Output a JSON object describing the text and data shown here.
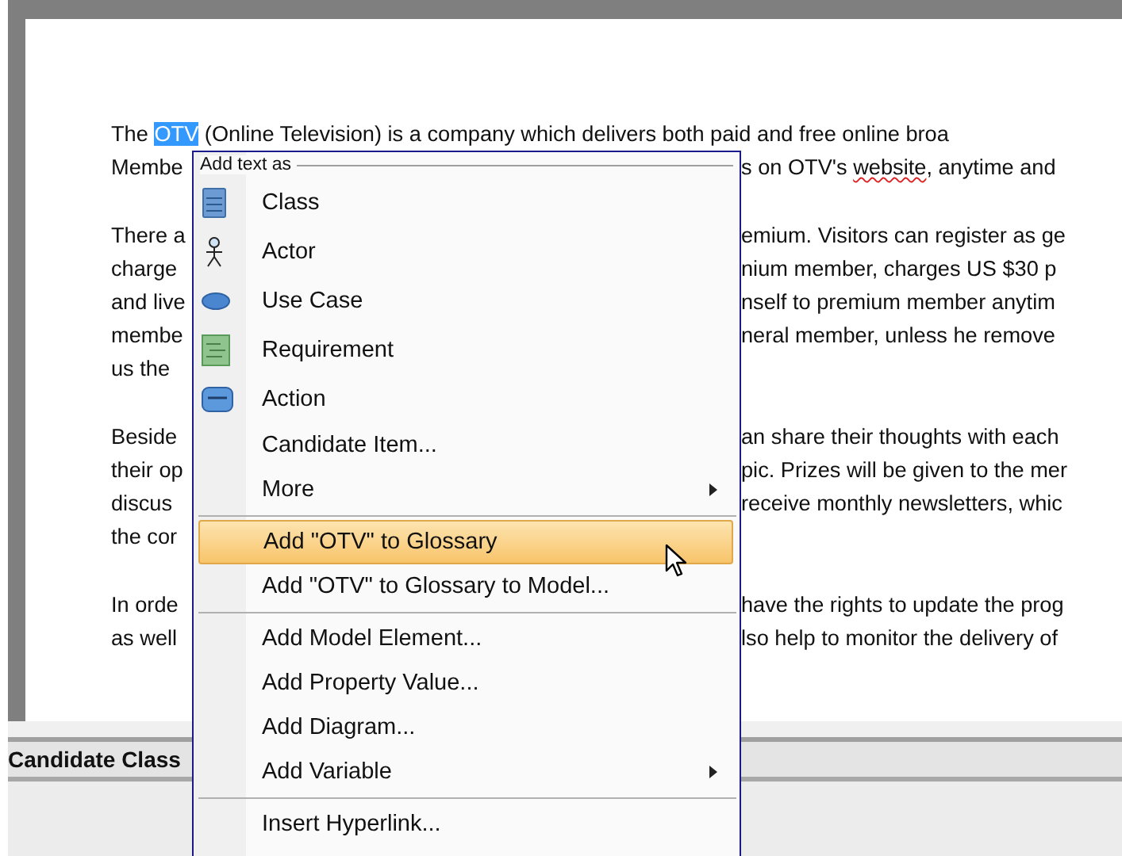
{
  "document": {
    "paragraphs": [
      {
        "lines": [
          {
            "left": [
              {
                "kind": "plain",
                "text": "The "
              },
              {
                "kind": "selected",
                "text": "OTV"
              },
              {
                "kind": "plain",
                "text": " (Online Television) is a company which delivers both paid and free online broa"
              }
            ]
          },
          {
            "left": [
              {
                "kind": "plain",
                "text": "Membe"
              }
            ],
            "right": [
              {
                "kind": "plain",
                "text": "s on OTV's "
              },
              {
                "kind": "misspelled",
                "text": "website"
              },
              {
                "kind": "plain",
                "text": ", anytime and"
              }
            ]
          }
        ]
      },
      {
        "lines": [
          {
            "left": [
              {
                "kind": "plain",
                "text": "There a"
              }
            ],
            "right": [
              {
                "kind": "plain",
                "text": "emium. Visitors can register as ge"
              }
            ]
          },
          {
            "left": [
              {
                "kind": "plain",
                "text": "charge"
              }
            ],
            "right": [
              {
                "kind": "plain",
                "text": "nium member, charges US $30 p"
              }
            ]
          },
          {
            "left": [
              {
                "kind": "plain",
                "text": "and live"
              }
            ],
            "right": [
              {
                "kind": "plain",
                "text": "nself to premium member anytim"
              }
            ]
          },
          {
            "left": [
              {
                "kind": "plain",
                "text": "membe"
              }
            ],
            "right": [
              {
                "kind": "plain",
                "text": "neral member, unless he remove"
              }
            ]
          },
          {
            "left": [
              {
                "kind": "plain",
                "text": "us the"
              }
            ]
          }
        ]
      },
      {
        "lines": [
          {
            "left": [
              {
                "kind": "plain",
                "text": "Beside"
              }
            ],
            "right": [
              {
                "kind": "plain",
                "text": "an share their thoughts with each"
              }
            ]
          },
          {
            "left": [
              {
                "kind": "plain",
                "text": "their op"
              }
            ],
            "right": [
              {
                "kind": "plain",
                "text": "pic. Prizes will be given to the mer"
              }
            ]
          },
          {
            "left": [
              {
                "kind": "plain",
                "text": "discus"
              }
            ],
            "right": [
              {
                "kind": "plain",
                "text": "receive monthly newsletters, whic"
              }
            ]
          },
          {
            "left": [
              {
                "kind": "plain",
                "text": "the cor"
              }
            ]
          }
        ]
      },
      {
        "lines": [
          {
            "left": [
              {
                "kind": "plain",
                "text": "In orde"
              }
            ],
            "right": [
              {
                "kind": "plain",
                "text": "have the rights to update the prog"
              }
            ]
          },
          {
            "left": [
              {
                "kind": "plain",
                "text": "as well"
              }
            ],
            "right": [
              {
                "kind": "plain",
                "text": "lso help to monitor the delivery of"
              }
            ]
          }
        ]
      }
    ]
  },
  "panel": {
    "title": "Candidate Class"
  },
  "context_menu": {
    "header": "Add text as",
    "items": [
      {
        "kind": "class",
        "label": "Class",
        "highlighted": false
      },
      {
        "kind": "actor",
        "label": "Actor",
        "highlighted": false
      },
      {
        "kind": "usecase",
        "label": "Use Case",
        "highlighted": false
      },
      {
        "kind": "requirement",
        "label": "Requirement",
        "highlighted": false
      },
      {
        "kind": "action",
        "label": "Action",
        "highlighted": false
      },
      {
        "kind": "plain",
        "label": "Candidate Item...",
        "highlighted": false
      },
      {
        "kind": "submenu",
        "label": "More",
        "highlighted": false
      },
      {
        "kind": "separator"
      },
      {
        "kind": "plain",
        "label": "Add \"OTV\" to Glossary",
        "highlighted": true
      },
      {
        "kind": "plain",
        "label": "Add \"OTV\" to Glossary to Model...",
        "highlighted": false
      },
      {
        "kind": "separator"
      },
      {
        "kind": "plain",
        "label": "Add Model Element...",
        "highlighted": false
      },
      {
        "kind": "plain",
        "label": "Add Property Value...",
        "highlighted": false
      },
      {
        "kind": "plain",
        "label": "Add Diagram...",
        "highlighted": false
      },
      {
        "kind": "submenu",
        "label": "Add Variable",
        "highlighted": false
      },
      {
        "kind": "separator"
      },
      {
        "kind": "plain",
        "label": "Insert Hyperlink...",
        "highlighted": false
      }
    ]
  }
}
